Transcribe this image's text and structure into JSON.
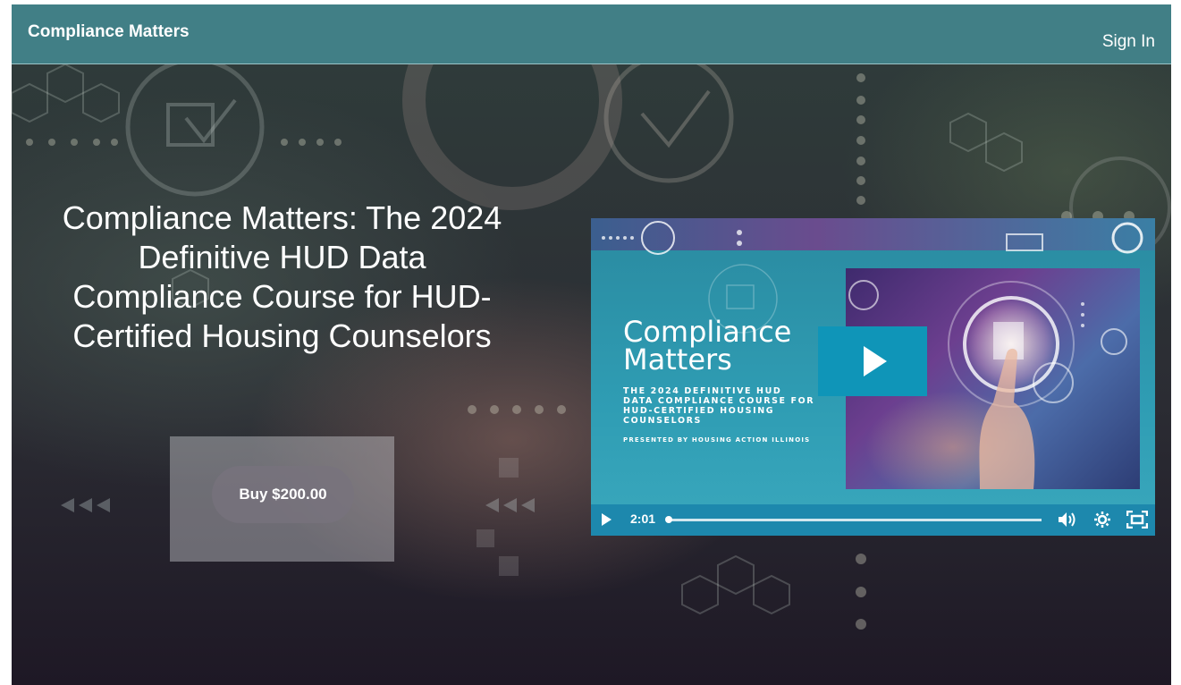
{
  "navbar": {
    "brand": "Compliance Matters",
    "sign_in": "Sign In"
  },
  "hero": {
    "headline": "Compliance Matters: The 2024 Definitive HUD Data Compliance Course for HUD-Certified Housing Counselors",
    "buy_label": "Buy $200.00"
  },
  "video": {
    "title_line1": "Compliance",
    "title_line2": "Matters",
    "subtitle_line1": "THE 2024 DEFINITIVE HUD",
    "subtitle_line2": "DATA COMPLIANCE COURSE FOR",
    "subtitle_line3": "HUD-CERTIFIED HOUSING COUNSELORS",
    "presented_by": "PRESENTED BY HOUSING ACTION ILLINOIS",
    "duration": "2:01",
    "progress": 0
  },
  "colors": {
    "navbar": "#417f86",
    "play_button": "#0f95b8",
    "controls": "#1982aa"
  },
  "icons": [
    "play-icon",
    "volume-icon",
    "settings-icon",
    "fullscreen-icon"
  ]
}
